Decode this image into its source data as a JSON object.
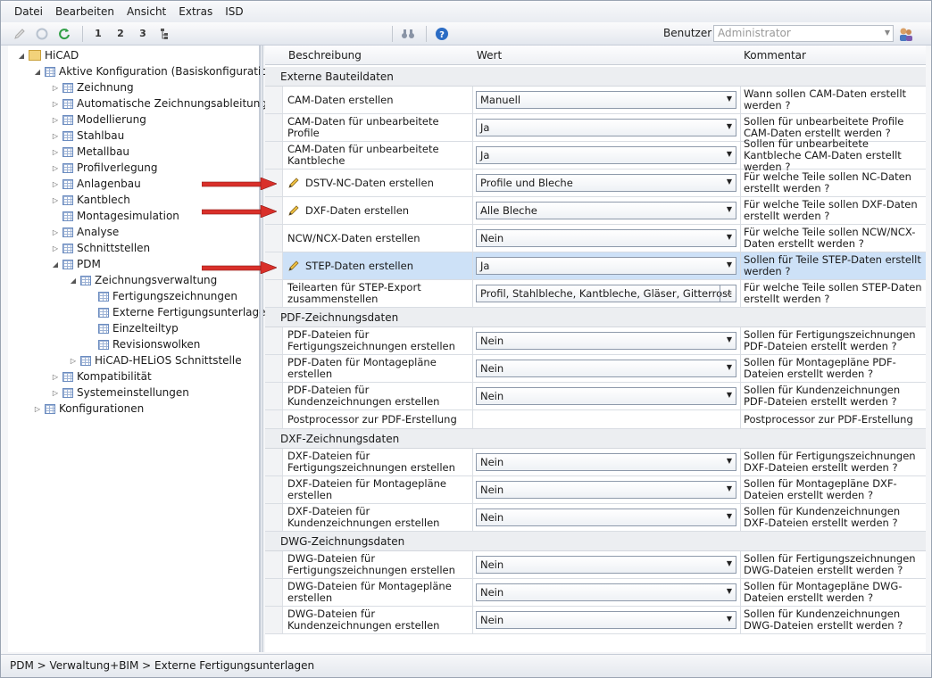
{
  "menu": [
    "Datei",
    "Bearbeiten",
    "Ansicht",
    "Extras",
    "ISD"
  ],
  "toolbar": {
    "benutzer_label": "Benutzer",
    "benutzer_value": "Administrator",
    "level_labels": [
      "1",
      "2",
      "3"
    ]
  },
  "tree": {
    "items": [
      {
        "label": "HiCAD",
        "level": 0,
        "expander": "expanded",
        "icon": "folder-icon"
      },
      {
        "label": "Aktive Konfiguration (Basiskonfiguration)",
        "level": 1,
        "expander": "expanded",
        "icon": "grid-icon"
      },
      {
        "label": "Zeichnung",
        "level": 2,
        "expander": "collapsed",
        "icon": "grid-icon"
      },
      {
        "label": "Automatische Zeichnungsableitung",
        "level": 2,
        "expander": "collapsed",
        "icon": "grid-icon"
      },
      {
        "label": "Modellierung",
        "level": 2,
        "expander": "collapsed",
        "icon": "grid-icon"
      },
      {
        "label": "Stahlbau",
        "level": 2,
        "expander": "collapsed",
        "icon": "grid-icon"
      },
      {
        "label": "Metallbau",
        "level": 2,
        "expander": "collapsed",
        "icon": "grid-icon"
      },
      {
        "label": "Profilverlegung",
        "level": 2,
        "expander": "collapsed",
        "icon": "grid-icon"
      },
      {
        "label": "Anlagenbau",
        "level": 2,
        "expander": "collapsed",
        "icon": "grid-icon"
      },
      {
        "label": "Kantblech",
        "level": 2,
        "expander": "collapsed",
        "icon": "grid-icon"
      },
      {
        "label": "Montagesimulation",
        "level": 2,
        "expander": "none",
        "icon": "grid-icon"
      },
      {
        "label": "Analyse",
        "level": 2,
        "expander": "collapsed",
        "icon": "grid-icon"
      },
      {
        "label": "Schnittstellen",
        "level": 2,
        "expander": "collapsed",
        "icon": "grid-icon"
      },
      {
        "label": "PDM",
        "level": 2,
        "expander": "expanded",
        "icon": "grid-icon"
      },
      {
        "label": "Zeichnungsverwaltung",
        "level": 3,
        "expander": "expanded",
        "icon": "grid-icon"
      },
      {
        "label": "Fertigungszeichnungen",
        "level": 4,
        "expander": "none",
        "icon": "grid-icon"
      },
      {
        "label": "Externe Fertigungsunterlagen",
        "level": 4,
        "expander": "none",
        "icon": "grid-icon"
      },
      {
        "label": "Einzelteiltyp",
        "level": 4,
        "expander": "none",
        "icon": "grid-icon"
      },
      {
        "label": "Revisionswolken",
        "level": 4,
        "expander": "none",
        "icon": "grid-icon"
      },
      {
        "label": "HiCAD-HELiOS Schnittstelle",
        "level": 3,
        "expander": "collapsed",
        "icon": "grid-icon"
      },
      {
        "label": "Kompatibilität",
        "level": 2,
        "expander": "collapsed",
        "icon": "grid-icon"
      },
      {
        "label": "Systemeinstellungen",
        "level": 2,
        "expander": "collapsed",
        "icon": "grid-icon"
      },
      {
        "label": "Konfigurationen",
        "level": 1,
        "expander": "collapsed",
        "icon": "grid-icon"
      }
    ]
  },
  "grid": {
    "columns": [
      "Beschreibung",
      "Wert",
      "Kommentar"
    ],
    "sections": [
      {
        "title": "Externe Bauteildaten",
        "rows": [
          {
            "desc": "CAM-Daten erstellen",
            "value": "Manuell",
            "comment": "Wann sollen CAM-Daten erstellt werden ?",
            "edited": false,
            "control": "combo"
          },
          {
            "desc": "CAM-Daten für unbearbeitete Profile",
            "value": "Ja",
            "comment": "Sollen für unbearbeitete Profile CAM-Daten erstellt werden ?",
            "edited": false,
            "control": "combo"
          },
          {
            "desc": "CAM-Daten für unbearbeitete Kantbleche",
            "value": "Ja",
            "comment": "Sollen für unbearbeitete Kantbleche CAM-Daten erstellt werden ?",
            "edited": false,
            "control": "combo"
          },
          {
            "desc": "DSTV-NC-Daten erstellen",
            "value": "Profile und Bleche",
            "comment": "Für welche Teile sollen NC-Daten erstellt werden ?",
            "edited": true,
            "control": "combo"
          },
          {
            "desc": "DXF-Daten erstellen",
            "value": "Alle Bleche",
            "comment": "Für welche Teile sollen DXF-Daten erstellt werden ?",
            "edited": true,
            "control": "combo"
          },
          {
            "desc": "NCW/NCX-Daten erstellen",
            "value": "Nein",
            "comment": "Für welche Teile sollen NCW/NCX-Daten erstellt werden ?",
            "edited": false,
            "control": "combo"
          },
          {
            "desc": "STEP-Daten erstellen",
            "value": "Ja",
            "comment": "Sollen für Teile STEP-Daten erstellt werden ?",
            "edited": true,
            "control": "combo",
            "selected": true
          },
          {
            "desc": "Teilearten für STEP-Export zusammenstellen",
            "value": "Profil, Stahlbleche, Kantbleche, Gläser, Gitterrost",
            "comment": "Für welche Teile sollen STEP-Daten erstellt werden ?",
            "edited": false,
            "control": "ellipsis"
          }
        ]
      },
      {
        "title": "PDF-Zeichnungsdaten",
        "rows": [
          {
            "desc": "PDF-Dateien für Fertigungszeichnungen erstellen",
            "value": "Nein",
            "comment": "Sollen für Fertigungszeichnungen PDF-Dateien erstellt werden ?",
            "edited": false,
            "control": "combo"
          },
          {
            "desc": "PDF-Daten für Montagepläne erstellen",
            "value": "Nein",
            "comment": "Sollen für Montagepläne PDF-Dateien erstellt werden ?",
            "edited": false,
            "control": "combo"
          },
          {
            "desc": "PDF-Dateien für Kundenzeichnungen erstellen",
            "value": "Nein",
            "comment": "Sollen für Kundenzeichnungen PDF-Dateien erstellt werden ?",
            "edited": false,
            "control": "combo"
          },
          {
            "desc": "Postprocessor zur PDF-Erstellung",
            "value": "",
            "comment": "Postprocessor zur PDF-Erstellung",
            "edited": false,
            "control": "none",
            "short": true
          }
        ]
      },
      {
        "title": "DXF-Zeichnungsdaten",
        "rows": [
          {
            "desc": "DXF-Dateien für Fertigungszeichnungen erstellen",
            "value": "Nein",
            "comment": "Sollen für Fertigungszeichnungen DXF-Dateien erstellt werden ?",
            "edited": false,
            "control": "combo"
          },
          {
            "desc": "DXF-Dateien für Montagepläne erstellen",
            "value": "Nein",
            "comment": "Sollen für Montagepläne DXF-Dateien erstellt werden ?",
            "edited": false,
            "control": "combo"
          },
          {
            "desc": "DXF-Dateien für Kundenzeichnungen erstellen",
            "value": "Nein",
            "comment": "Sollen für Kundenzeichnungen DXF-Dateien erstellt werden ?",
            "edited": false,
            "control": "combo"
          }
        ]
      },
      {
        "title": "DWG-Zeichnungsdaten",
        "rows": [
          {
            "desc": "DWG-Dateien für Fertigungszeichnungen erstellen",
            "value": "Nein",
            "comment": "Sollen für Fertigungszeichnungen DWG-Dateien erstellt werden ?",
            "edited": false,
            "control": "combo"
          },
          {
            "desc": "DWG-Dateien für Montagepläne erstellen",
            "value": "Nein",
            "comment": "Sollen für Montagepläne DWG-Dateien erstellt werden ?",
            "edited": false,
            "control": "combo"
          },
          {
            "desc": "DWG-Dateien für Kundenzeichnungen erstellen",
            "value": "Nein",
            "comment": "Sollen für Kundenzeichnungen DWG-Dateien erstellt werden ?",
            "edited": false,
            "control": "combo"
          }
        ]
      }
    ]
  },
  "statusbar": {
    "path": "PDM > Verwaltung+BIM > Externe Fertigungsunterlagen"
  },
  "colors": {
    "selected_row": "#cde1f7",
    "arrow": "#d9302a",
    "pencil": "#c9922a"
  }
}
